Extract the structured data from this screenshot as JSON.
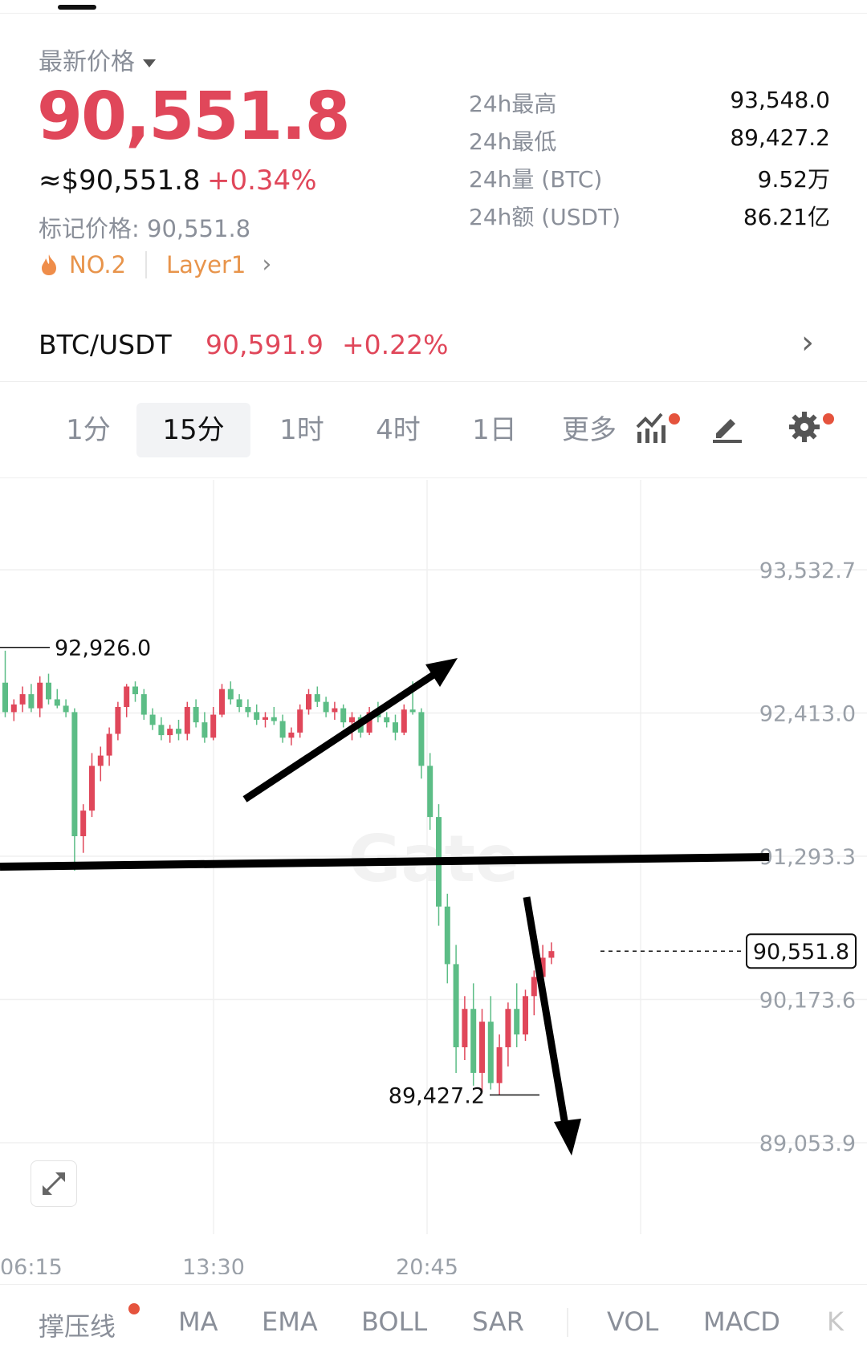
{
  "header": {
    "latest_label": "最新价格",
    "price": "90,551.8",
    "usd_price": "≈$90,551.8",
    "change": "+0.34%",
    "mark_price": "标记价格: 90,551.8",
    "rank": "NO.2",
    "tag": "Layer1"
  },
  "stats": [
    {
      "label": "24h最高",
      "value": "93,548.0"
    },
    {
      "label": "24h最低",
      "value": "89,427.2"
    },
    {
      "label": "24h量 (BTC)",
      "value": "9.52万"
    },
    {
      "label": "24h额 (USDT)",
      "value": "86.21亿"
    }
  ],
  "pair": {
    "name": "BTC/USDT",
    "price": "90,591.9",
    "change": "+0.22%"
  },
  "timeframes": [
    "1分",
    "15分",
    "1时",
    "4时",
    "1日",
    "更多"
  ],
  "active_timeframe": "15分",
  "chart_data": {
    "type": "candlestick",
    "y_axis_labels": [
      "93,532.7",
      "92,413.0",
      "91,293.3",
      "90,173.6",
      "89,053.9"
    ],
    "x_axis_labels": [
      "06:15",
      "13:30",
      "20:45"
    ],
    "high_marker": "92,926.0",
    "low_marker": "89,427.2",
    "last_price": "90,551.8",
    "ylim": [
      89053.9,
      93532.7
    ],
    "watermark": "Gate",
    "candles": [
      [
        92650,
        92900,
        92380,
        92420
      ],
      [
        92420,
        92520,
        92350,
        92480
      ],
      [
        92480,
        92620,
        92420,
        92560
      ],
      [
        92560,
        92640,
        92420,
        92450
      ],
      [
        92450,
        92700,
        92380,
        92650
      ],
      [
        92650,
        92720,
        92480,
        92520
      ],
      [
        92520,
        92600,
        92450,
        92470
      ],
      [
        92470,
        92520,
        92380,
        92420
      ],
      [
        92420,
        92450,
        91180,
        91450
      ],
      [
        91450,
        91700,
        91320,
        91650
      ],
      [
        91650,
        92100,
        91600,
        92000
      ],
      [
        92000,
        92150,
        91880,
        92080
      ],
      [
        92080,
        92300,
        92000,
        92250
      ],
      [
        92250,
        92500,
        92200,
        92460
      ],
      [
        92460,
        92640,
        92380,
        92620
      ],
      [
        92620,
        92660,
        92500,
        92560
      ],
      [
        92560,
        92600,
        92360,
        92400
      ],
      [
        92400,
        92450,
        92280,
        92320
      ],
      [
        92320,
        92380,
        92200,
        92240
      ],
      [
        92240,
        92320,
        92180,
        92290
      ],
      [
        92290,
        92360,
        92200,
        92250
      ],
      [
        92250,
        92500,
        92200,
        92460
      ],
      [
        92460,
        92520,
        92300,
        92340
      ],
      [
        92340,
        92420,
        92180,
        92220
      ],
      [
        92220,
        92460,
        92200,
        92400
      ],
      [
        92400,
        92640,
        92380,
        92600
      ],
      [
        92600,
        92660,
        92480,
        92520
      ],
      [
        92520,
        92560,
        92420,
        92460
      ],
      [
        92460,
        92520,
        92380,
        92420
      ],
      [
        92420,
        92480,
        92320,
        92360
      ],
      [
        92360,
        92420,
        92300,
        92380
      ],
      [
        92380,
        92460,
        92320,
        92350
      ],
      [
        92350,
        92400,
        92180,
        92220
      ],
      [
        92220,
        92300,
        92160,
        92260
      ],
      [
        92260,
        92480,
        92220,
        92440
      ],
      [
        92440,
        92600,
        92400,
        92560
      ],
      [
        92560,
        92620,
        92460,
        92500
      ],
      [
        92500,
        92540,
        92380,
        92420
      ],
      [
        92420,
        92500,
        92360,
        92450
      ],
      [
        92450,
        92480,
        92300,
        92340
      ],
      [
        92340,
        92420,
        92200,
        92380
      ],
      [
        92380,
        92400,
        92220,
        92260
      ],
      [
        92260,
        92460,
        92240,
        92420
      ],
      [
        92420,
        92500,
        92340,
        92380
      ],
      [
        92380,
        92420,
        92300,
        92340
      ],
      [
        92340,
        92400,
        92200,
        92260
      ],
      [
        92260,
        92480,
        92240,
        92440
      ],
      [
        92440,
        92660,
        92400,
        92420
      ],
      [
        92420,
        92450,
        91900,
        92000
      ],
      [
        92000,
        92100,
        91500,
        91600
      ],
      [
        91600,
        91700,
        90750,
        90900
      ],
      [
        90900,
        91000,
        90300,
        90450
      ],
      [
        90450,
        90600,
        89600,
        89800
      ],
      [
        89800,
        90200,
        89700,
        90100
      ],
      [
        90100,
        90300,
        89500,
        89600
      ],
      [
        89600,
        90100,
        89450,
        90000
      ],
      [
        90000,
        90200,
        89470,
        89520
      ],
      [
        89520,
        89900,
        89430,
        89800
      ],
      [
        89800,
        90150,
        89650,
        90100
      ],
      [
        90100,
        90300,
        89800,
        89900
      ],
      [
        89900,
        90250,
        89850,
        90200
      ],
      [
        90200,
        90400,
        90050,
        90350
      ],
      [
        90350,
        90600,
        90300,
        90500
      ],
      [
        90500,
        90620,
        90450,
        90552
      ]
    ]
  },
  "indicators": [
    "撑压线",
    "MA",
    "EMA",
    "BOLL",
    "SAR",
    "VOL",
    "MACD",
    "K"
  ],
  "colors": {
    "up": "#e0475a",
    "down": "#5cbd86",
    "accent_orange": "#e8944b",
    "dot": "#e5533d"
  }
}
